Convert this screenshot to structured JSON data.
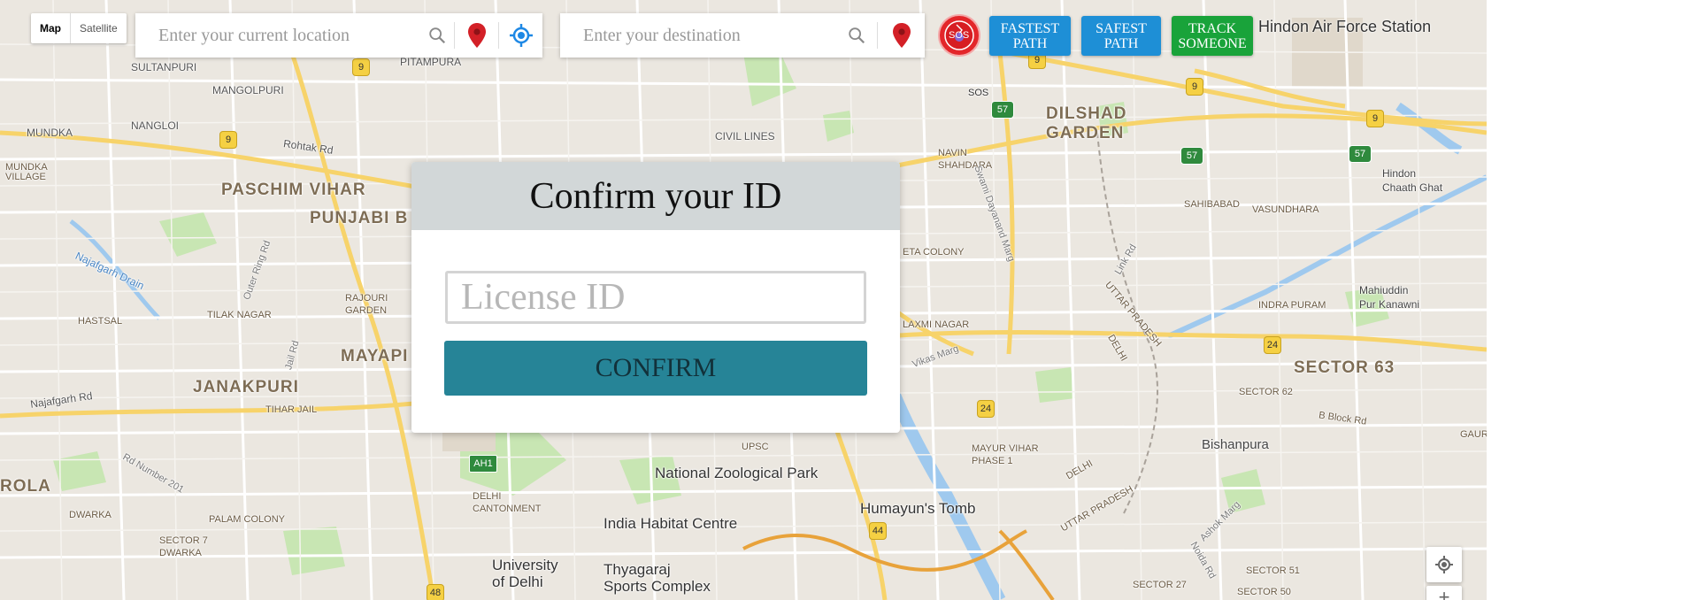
{
  "map_type": {
    "map_label": "Map",
    "satellite_label": "Satellite"
  },
  "source_search": {
    "placeholder": "Enter your current location"
  },
  "destination_search": {
    "placeholder": "Enter your destination"
  },
  "sos": {
    "label": "SOS"
  },
  "buttons": {
    "fastest_path": "FASTEST\nPATH",
    "safest_path": "SAFEST\nPATH",
    "track_someone": "TRACK\nSOMEONE"
  },
  "modal": {
    "title": "Confirm your ID",
    "license_placeholder": "License ID",
    "confirm_label": "CONFIRM"
  },
  "map_labels": {
    "hindon_air_force": "Hindon Air Force Station",
    "sultanpuri": "SULTANPURI",
    "pitampura": "PITAMPURA",
    "mangolpuri": "MANGOLPURI",
    "nangloi": "NANGLOI",
    "mundka": "MUNDKA",
    "mundka_village": "MUNDKA\nVILLAGE",
    "rohtak_rd": "Rohtak Rd",
    "paschim_vihar": "PASCHIM VIHAR",
    "punjabi_bagh": "PUNJABI B",
    "civil_lines": "CIVIL LINES",
    "dilshad_garden": "DILSHAD\nGARDEN",
    "navin_shahdara": "NAVIN\nSHAHDARA",
    "hindon_chaath_ghat": "Hindon\nChaath Ghat",
    "sahibabad": "SAHIBABAD",
    "vasundhara": "VASUNDHARA",
    "najafgarh_drain": "Najafgarh Drain",
    "rajouri_garden": "RAJOURI\nGARDEN",
    "tilak_nagar": "TILAK NAGAR",
    "hastsal": "HASTSAL",
    "mayapuri": "MAYAPI",
    "janakpuri": "JANAKPURI",
    "tihar_jail": "TIHAR JAIL",
    "najafgarh_rd": "Najafgarh Rd",
    "rola": "ROLA",
    "dwarka": "DWARKA",
    "palam_colony": "PALAM COLONY",
    "sector_7_dwarka": "SECTOR 7\nDWARKA",
    "delhi_cantonment": "DELHI\nCANTONMENT",
    "ah1": "AH1",
    "upsc": "UPSC",
    "national_zoo": "National Zoological Park",
    "india_habitat": "India Habitat Centre",
    "humayuns_tomb": "Humayun's Tomb",
    "university_delhi": "University\nof Delhi",
    "thyagaraj": "Thyagaraj\nSports Complex",
    "laxmi_nagar": "LAXMI NAGAR",
    "preet_colony": "ETA COLONY",
    "mayur_vihar": "MAYUR VIHAR\nPHASE 1",
    "uttar_pradesh_1": "UTTAR PRADESH",
    "delhi_1": "DELHI",
    "uttar_pradesh_2": "UTTAR PRADESH",
    "delhi_2": "DELHI",
    "indra_puram": "INDRA PURAM",
    "mahiuddin": "Mahiuddin\nPur Kanawni",
    "sector_63": "SECTOR 63",
    "sector_62": "SECTOR 62",
    "b_block_rd": "B Block Rd",
    "bishanpura": "Bishanpura",
    "sector_51": "SECTOR 51",
    "sector_50": "SECTOR 50",
    "sector_27": "SECTOR 27",
    "sos_map": "SOS",
    "vikas_marg": "Vikas Marg",
    "link_rd": "Link Rd",
    "swami_dayanand": "Swami Dayanand Marg",
    "outer_ring_rd": "Outer Ring Rd",
    "jail_rd": "Jail Rd",
    "rd_number_201": "Rd Number 201",
    "ashok_marg": "Ashok Marg",
    "noida_rd": "Noida Rd",
    "gaur": "GAUR",
    "shield_9": "9",
    "shield_24": "24",
    "shield_44": "44",
    "shield_48": "48",
    "shield_57": "57"
  }
}
